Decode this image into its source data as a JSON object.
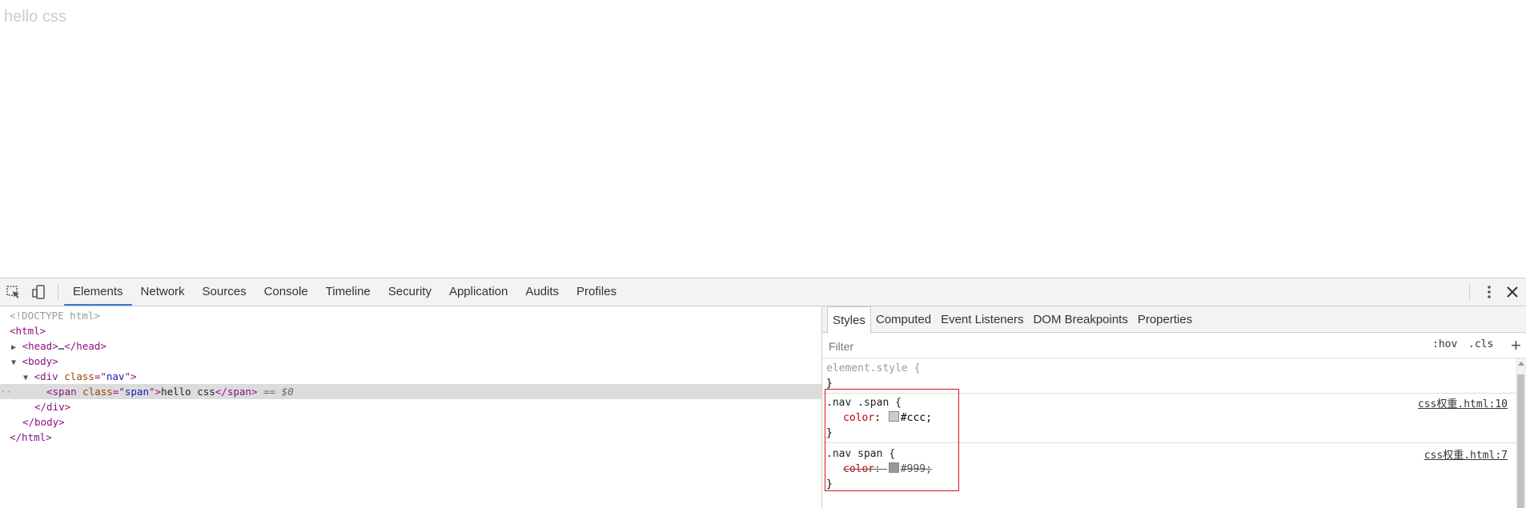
{
  "page": {
    "text": "hello css"
  },
  "toolbar": {
    "tabs": [
      "Elements",
      "Network",
      "Sources",
      "Console",
      "Timeline",
      "Security",
      "Application",
      "Audits",
      "Profiles"
    ],
    "active_tab": "Elements"
  },
  "dom": {
    "doctype": "<!DOCTYPE html>",
    "html_open": "<html>",
    "head": {
      "open": "<head>",
      "ellipsis": "…",
      "close": "</head>"
    },
    "body_open": "<body>",
    "div": {
      "tag": "div",
      "attr": "class",
      "value": "nav"
    },
    "span": {
      "tag": "span",
      "attr": "class",
      "value": "span",
      "text": "hello css",
      "marker": "== $0"
    },
    "div_close": "</div>",
    "body_close": "</body>",
    "html_close": "</html>"
  },
  "styles": {
    "tabs": [
      "Styles",
      "Computed",
      "Event Listeners",
      "DOM Breakpoints",
      "Properties"
    ],
    "active_tab": "Styles",
    "filter_placeholder": "Filter",
    "hov": ":hov",
    "cls": ".cls",
    "add": "+",
    "element_style": "element.style {",
    "close_brace": "}",
    "rules": [
      {
        "selector": ".nav .span {",
        "prop": "color",
        "value": "#ccc;",
        "swatch": "#cccccc",
        "source": "css权重.html:10",
        "overridden": false
      },
      {
        "selector": ".nav span {",
        "prop": "color",
        "value": "#999;",
        "swatch": "#999999",
        "source": "css权重.html:7",
        "overridden": true
      }
    ]
  },
  "colors": {
    "accent": "#3879d9",
    "highlight": "#d8141a"
  }
}
